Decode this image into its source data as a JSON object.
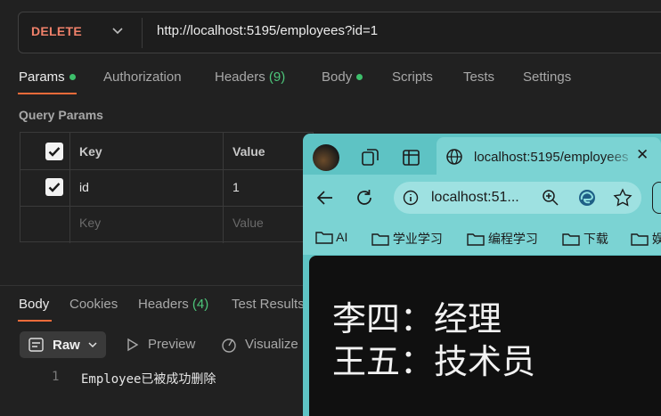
{
  "request": {
    "method": "DELETE",
    "url": "http://localhost:5195/employees?id=1"
  },
  "request_tabs": {
    "params": "Params",
    "authorization": "Authorization",
    "headers": "Headers",
    "headers_count": "(9)",
    "body": "Body",
    "scripts": "Scripts",
    "tests": "Tests",
    "settings": "Settings"
  },
  "query_params": {
    "title": "Query Params",
    "columns": {
      "key": "Key",
      "value": "Value"
    },
    "rows": [
      {
        "checked": true,
        "key": "id",
        "value": "1"
      }
    ],
    "placeholder": {
      "key": "Key",
      "value": "Value"
    }
  },
  "response_tabs": {
    "body": "Body",
    "cookies": "Cookies",
    "headers": "Headers",
    "headers_count": "(4)",
    "test_results": "Test Results"
  },
  "response_toolbar": {
    "raw": "Raw",
    "preview": "Preview",
    "visualize": "Visualize"
  },
  "response_body": {
    "line_number": "1",
    "text": "Employee已被成功删除"
  },
  "browser": {
    "tab_title": "localhost:5195/employees",
    "address": "localhost:51...",
    "favorites": [
      "AI",
      "学业学习",
      "编程学习",
      "下载",
      "娱"
    ],
    "content_lines": [
      "李四：经理",
      "王五：技术员"
    ]
  },
  "colors": {
    "accent": "#f26b3a",
    "method": "#f0816a",
    "status_green": "#3dbf6b",
    "browser_frame": "#5ec3c4"
  }
}
